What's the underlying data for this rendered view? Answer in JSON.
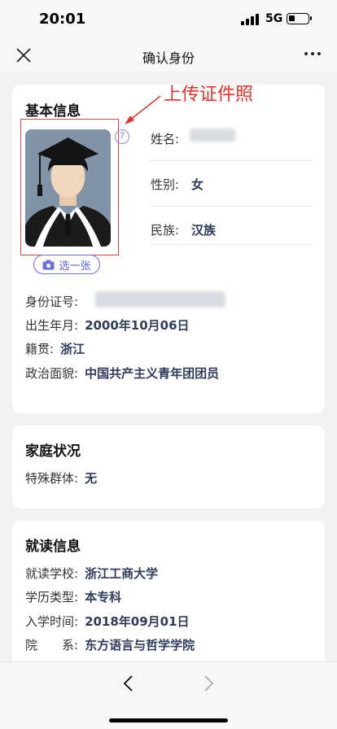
{
  "status": {
    "time": "20:01",
    "network": "5G",
    "battery_level": 0.35
  },
  "nav": {
    "title": "确认身份"
  },
  "annotation": {
    "upload_label": "上传证件照"
  },
  "basic": {
    "title": "基本信息",
    "help_glyph": "?",
    "choose_label": "选一张",
    "name_label": "姓名:",
    "gender_label": "性别:",
    "gender_value": "女",
    "ethnicity_label": "民族:",
    "ethnicity_value": "汉族",
    "id_label": "身份证号:",
    "birth_label": "出生年月:",
    "birth_value": "2000年10月06日",
    "native_label": "籍贯:",
    "native_value": "浙江",
    "political_label": "政治面貌:",
    "political_value": "中国共产主义青年团团员"
  },
  "family": {
    "title": "家庭状况",
    "special_label": "特殊群体:",
    "special_value": "无"
  },
  "study": {
    "title": "就读信息",
    "school_label": "就读学校:",
    "school_value": "浙江工商大学",
    "edu_label": "学历类型:",
    "edu_value": "本专科",
    "enroll_label": "入学时间:",
    "enroll_value": "2018年09月01日",
    "dept_label": "院　　系:",
    "dept_value": "东方语言与哲学学院"
  },
  "colors": {
    "accent": "#5c60d8",
    "value": "#2f3b59",
    "annotation": "#e4322b"
  }
}
